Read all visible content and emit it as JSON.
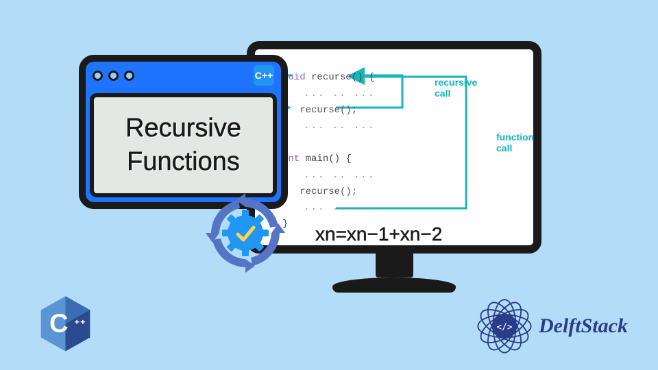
{
  "background_color": "#b3dcf9",
  "accent_blue": "#1e73ff",
  "teal": "#16b4bd",
  "appwin": {
    "cpp_badge": "C++",
    "title_line1": "Recursive",
    "title_line2": "Functions"
  },
  "code": {
    "line1_kw": "void",
    "line1_fn": " recurse() {",
    "line2": "   ... .. ...",
    "line3": "   recurse();",
    "line4": "   ... .. ...",
    "line5": "}",
    "line6": "",
    "line7_kw": "int",
    "line7_fn": " main() {",
    "line8": "   ... .. ...",
    "line9": "   recurse();",
    "line10": "   ... .. ...",
    "line11": "}"
  },
  "annotations": {
    "recursive_call": "recursive\ncall",
    "function_call": "function\ncall"
  },
  "equation": "xn=xn−1+xn−2",
  "footer": {
    "cpp_label": "C++",
    "brand": "DelftStack"
  }
}
